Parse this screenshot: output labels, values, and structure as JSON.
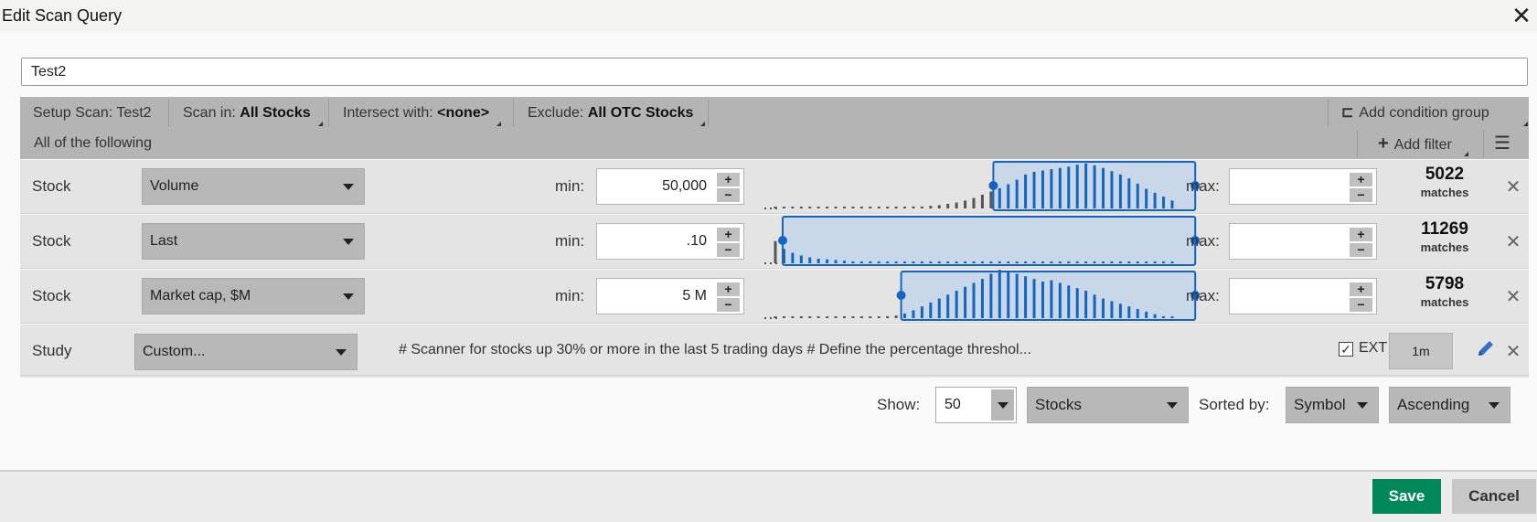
{
  "window": {
    "title": "Edit Scan Query",
    "close_icon": "close-icon"
  },
  "scan_name": "Test2",
  "header": {
    "setup_scan": "Setup Scan: Test2",
    "scan_in_label": "Scan in:",
    "scan_in_value": "All Stocks",
    "intersect_label": "Intersect with:",
    "intersect_value": "<none>",
    "exclude_label": "Exclude:",
    "exclude_value": "All OTC Stocks",
    "condition_mode": "All of the following",
    "add_condition_group": "Add condition group",
    "add_filter": "Add filter"
  },
  "filters": [
    {
      "type": "Stock",
      "field": "Volume",
      "min_label": "min:",
      "min": "50,000",
      "max_label": "max:",
      "max": "",
      "matches": "5022",
      "matches_label": "matches",
      "histogram": {
        "range_start": 0.53,
        "range_end": 0.99,
        "bars": [
          2,
          2,
          2,
          2,
          2,
          2,
          2,
          2,
          2,
          2,
          2,
          2,
          2,
          2,
          2,
          2,
          3,
          3,
          4,
          5,
          7,
          9,
          12,
          16,
          21,
          26,
          31,
          37,
          44,
          52,
          56,
          58,
          60,
          62,
          64,
          67,
          69,
          66,
          62,
          57,
          52,
          46,
          38,
          30,
          24,
          18,
          12
        ]
      }
    },
    {
      "type": "Stock",
      "field": "Last",
      "min_label": "min:",
      "min": ".10",
      "max_label": "max:",
      "max": "",
      "matches": "11269",
      "matches_label": "matches",
      "histogram": {
        "range_start": 0.05,
        "range_end": 0.99,
        "bars": [
          34,
          22,
          16,
          12,
          9,
          7,
          6,
          5,
          4,
          3,
          3,
          3,
          2,
          2,
          2,
          2,
          2,
          2,
          2,
          2,
          2,
          2,
          2,
          2,
          2,
          2,
          2,
          2,
          2,
          2,
          2,
          2,
          2,
          2,
          2,
          2,
          2,
          2,
          2,
          2,
          2,
          2,
          2,
          2,
          2,
          2,
          2
        ]
      }
    },
    {
      "type": "Stock",
      "field": "Market cap, $M",
      "min_label": "min:",
      "min": "5 M",
      "max_label": "max:",
      "max": "",
      "matches": "5798",
      "matches_label": "matches",
      "histogram": {
        "range_start": 0.32,
        "range_end": 0.99,
        "bars": [
          2,
          2,
          2,
          2,
          2,
          2,
          2,
          2,
          2,
          2,
          2,
          2,
          2,
          3,
          4,
          7,
          12,
          18,
          24,
          30,
          36,
          42,
          48,
          54,
          60,
          68,
          74,
          72,
          68,
          64,
          60,
          56,
          58,
          54,
          50,
          46,
          42,
          36,
          30,
          26,
          22,
          18,
          14,
          10,
          6,
          3,
          2
        ]
      }
    }
  ],
  "study": {
    "type": "Study",
    "field": "Custom...",
    "script": "# Scanner for stocks up 30% or more in the last 5 trading days # Define the percentage threshol...",
    "ext_label": "EXT",
    "aggregation": "1m",
    "edit_icon": "pencil-icon"
  },
  "bottom": {
    "show_label": "Show:",
    "show_value": "50",
    "universe": "Stocks",
    "sorted_by_label": "Sorted by:",
    "sort_field": "Symbol",
    "sort_order": "Ascending"
  },
  "footer": {
    "save": "Save",
    "cancel": "Cancel"
  },
  "colors": {
    "accent": "#1565c0",
    "range_fill": "#c8d8e8",
    "save": "#00875a"
  }
}
